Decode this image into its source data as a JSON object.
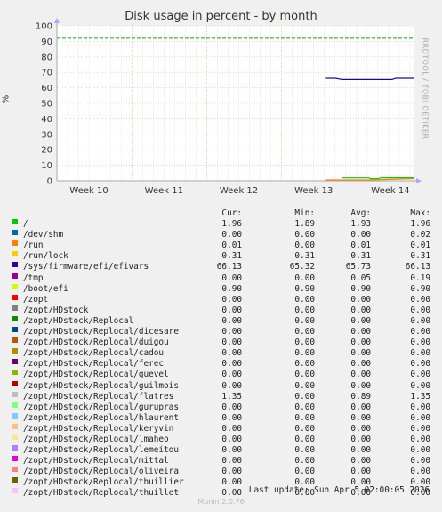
{
  "chart_data": {
    "type": "line",
    "title": "Disk usage in percent - by month",
    "ylabel": "%",
    "ylim": [
      0,
      100
    ],
    "yticks": [
      0,
      10,
      20,
      30,
      40,
      50,
      60,
      70,
      80,
      90,
      100
    ],
    "xticks": [
      "Week 10",
      "Week 11",
      "Week 12",
      "Week 13",
      "Week 14"
    ],
    "warning_line": 92,
    "series": [
      {
        "name": "/sys/firmware/efi/efivars",
        "color": "#1a0c8c",
        "points": [
          [
            0.754,
            66.1
          ],
          [
            0.78,
            66.1
          ],
          [
            0.8,
            65.3
          ],
          [
            0.94,
            65.3
          ],
          [
            0.95,
            66.1
          ],
          [
            1.0,
            66.1
          ]
        ]
      },
      {
        "name": "/",
        "color": "#00cc00",
        "points": [
          [
            0.8,
            1.9
          ],
          [
            0.874,
            1.9
          ],
          [
            0.88,
            1.4
          ],
          [
            0.9,
            1.4
          ],
          [
            0.91,
            1.96
          ],
          [
            1.0,
            1.96
          ]
        ]
      },
      {
        "name": "/zopt/HDstock/Replocal/flatres",
        "color": "#ff8000",
        "points": [
          [
            0.754,
            0.6
          ],
          [
            0.8,
            0.6
          ],
          [
            0.88,
            0.6
          ],
          [
            1.0,
            1.35
          ]
        ]
      }
    ]
  },
  "side_text": "RRDTOOL / TOBI OETIKER",
  "legend": {
    "headers": [
      "Cur:",
      "Min:",
      "Avg:",
      "Max:"
    ],
    "rows": [
      {
        "name": "/",
        "color": "#00cc00",
        "cur": "1.96",
        "min": "1.89",
        "avg": "1.93",
        "max": "1.96"
      },
      {
        "name": "/dev/shm",
        "color": "#0066b3",
        "cur": "0.00",
        "min": "0.00",
        "avg": "0.00",
        "max": "0.02"
      },
      {
        "name": "/run",
        "color": "#ff8000",
        "cur": "0.01",
        "min": "0.00",
        "avg": "0.01",
        "max": "0.01"
      },
      {
        "name": "/run/lock",
        "color": "#ffcc00",
        "cur": "0.31",
        "min": "0.31",
        "avg": "0.31",
        "max": "0.31"
      },
      {
        "name": "/sys/firmware/efi/efivars",
        "color": "#330099",
        "cur": "66.13",
        "min": "65.32",
        "avg": "65.73",
        "max": "66.13"
      },
      {
        "name": "/tmp",
        "color": "#990099",
        "cur": "0.00",
        "min": "0.00",
        "avg": "0.05",
        "max": "0.19"
      },
      {
        "name": "/boot/efi",
        "color": "#ccff00",
        "cur": "0.90",
        "min": "0.90",
        "avg": "0.90",
        "max": "0.90"
      },
      {
        "name": "/zopt",
        "color": "#ff0000",
        "cur": "0.00",
        "min": "0.00",
        "avg": "0.00",
        "max": "0.00"
      },
      {
        "name": "/zopt/HDstock",
        "color": "#808080",
        "cur": "0.00",
        "min": "0.00",
        "avg": "0.00",
        "max": "0.00"
      },
      {
        "name": "/zopt/HDstock/Replocal",
        "color": "#008f00",
        "cur": "0.00",
        "min": "0.00",
        "avg": "0.00",
        "max": "0.00"
      },
      {
        "name": "/zopt/HDstock/Replocal/dicesare",
        "color": "#00487d",
        "cur": "0.00",
        "min": "0.00",
        "avg": "0.00",
        "max": "0.00"
      },
      {
        "name": "/zopt/HDstock/Replocal/duigou",
        "color": "#b35a00",
        "cur": "0.00",
        "min": "0.00",
        "avg": "0.00",
        "max": "0.00"
      },
      {
        "name": "/zopt/HDstock/Replocal/cadou",
        "color": "#b38f00",
        "cur": "0.00",
        "min": "0.00",
        "avg": "0.00",
        "max": "0.00"
      },
      {
        "name": "/zopt/HDstock/Replocal/ferec",
        "color": "#6b006b",
        "cur": "0.00",
        "min": "0.00",
        "avg": "0.00",
        "max": "0.00"
      },
      {
        "name": "/zopt/HDstock/Replocal/guevel",
        "color": "#8fb300",
        "cur": "0.00",
        "min": "0.00",
        "avg": "0.00",
        "max": "0.00"
      },
      {
        "name": "/zopt/HDstock/Replocal/guilmois",
        "color": "#b30000",
        "cur": "0.00",
        "min": "0.00",
        "avg": "0.00",
        "max": "0.00"
      },
      {
        "name": "/zopt/HDstock/Replocal/flatres",
        "color": "#bebebe",
        "cur": "1.35",
        "min": "0.00",
        "avg": "0.89",
        "max": "1.35"
      },
      {
        "name": "/zopt/HDstock/Replocal/gurupras",
        "color": "#80ff80",
        "cur": "0.00",
        "min": "0.00",
        "avg": "0.00",
        "max": "0.00"
      },
      {
        "name": "/zopt/HDstock/Replocal/hlaurent",
        "color": "#80c9ff",
        "cur": "0.00",
        "min": "0.00",
        "avg": "0.00",
        "max": "0.00"
      },
      {
        "name": "/zopt/HDstock/Replocal/keryvin",
        "color": "#ffc080",
        "cur": "0.00",
        "min": "0.00",
        "avg": "0.00",
        "max": "0.00"
      },
      {
        "name": "/zopt/HDstock/Replocal/lmaheo",
        "color": "#ffe680",
        "cur": "0.00",
        "min": "0.00",
        "avg": "0.00",
        "max": "0.00"
      },
      {
        "name": "/zopt/HDstock/Replocal/lemeitou",
        "color": "#aa80ff",
        "cur": "0.00",
        "min": "0.00",
        "avg": "0.00",
        "max": "0.00"
      },
      {
        "name": "/zopt/HDstock/Replocal/mittal",
        "color": "#ee00cc",
        "cur": "0.00",
        "min": "0.00",
        "avg": "0.00",
        "max": "0.00"
      },
      {
        "name": "/zopt/HDstock/Replocal/oliveira",
        "color": "#ff8080",
        "cur": "0.00",
        "min": "0.00",
        "avg": "0.00",
        "max": "0.00"
      },
      {
        "name": "/zopt/HDstock/Replocal/thuillier",
        "color": "#666600",
        "cur": "0.00",
        "min": "0.00",
        "avg": "0.00",
        "max": "0.00"
      },
      {
        "name": "/zopt/HDstock/Replocal/thuillet",
        "color": "#ffbfff",
        "cur": "0.00",
        "min": "0.00",
        "avg": "0.00",
        "max": "0.00"
      }
    ]
  },
  "footer": {
    "last_update": "Last update: Sun Apr  5 02:00:05 2026",
    "version": "Munin 2.0.76"
  }
}
